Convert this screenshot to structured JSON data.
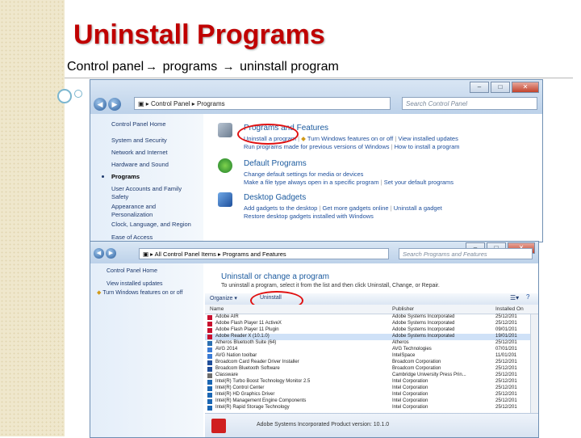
{
  "slide": {
    "title": "Uninstall Programs",
    "path": [
      "Control panel",
      "programs",
      "uninstall program"
    ]
  },
  "window1": {
    "address": [
      "Control Panel",
      "Programs"
    ],
    "search_placeholder": "Search Control Panel",
    "sidebar": [
      {
        "label": "Control Panel Home",
        "current": false
      },
      {
        "label": "System and Security",
        "current": false
      },
      {
        "label": "Network and Internet",
        "current": false
      },
      {
        "label": "Hardware and Sound",
        "current": false
      },
      {
        "label": "Programs",
        "current": true
      },
      {
        "label": "User Accounts and Family Safety",
        "current": false
      },
      {
        "label": "Appearance and Personalization",
        "current": false
      },
      {
        "label": "Clock, Language, and Region",
        "current": false
      },
      {
        "label": "Ease of Access",
        "current": false
      }
    ],
    "categories": [
      {
        "title": "Programs and Features",
        "links1": [
          "Uninstall a program",
          "Turn Windows features on or off",
          "View installed updates"
        ],
        "links2": [
          "Run programs made for previous versions of Windows",
          "How to install a program"
        ]
      },
      {
        "title": "Default Programs",
        "links1": [
          "Change default settings for media or devices"
        ],
        "links2": [
          "Make a file type always open in a specific program",
          "Set your default programs"
        ]
      },
      {
        "title": "Desktop Gadgets",
        "links1": [
          "Add gadgets to the desktop",
          "Get more gadgets online",
          "Uninstall a gadget"
        ],
        "links2": [
          "Restore desktop gadgets installed with Windows"
        ]
      }
    ]
  },
  "window2": {
    "address": [
      "All Control Panel Items",
      "Programs and Features"
    ],
    "search_placeholder": "Search Programs and Features",
    "sidebar": [
      "Control Panel Home",
      "View installed updates",
      "Turn Windows features on or off"
    ],
    "heading": "Uninstall or change a program",
    "subtext": "To uninstall a program, select it from the list and then click Uninstall, Change, or Repair.",
    "toolbar": {
      "organize": "Organize ▾",
      "uninstall": "Uninstall"
    },
    "columns": [
      "Name",
      "Publisher",
      "Installed On"
    ],
    "rows": [
      {
        "name": "Adobe AIR",
        "publisher": "Adobe Systems Incorporated",
        "date": "25/12/201",
        "selected": false
      },
      {
        "name": "Adobe Flash Player 11 ActiveX",
        "publisher": "Adobe Systems Incorporated",
        "date": "25/12/201",
        "selected": false
      },
      {
        "name": "Adobe Flash Player 11 Plugin",
        "publisher": "Adobe Systems Incorporated",
        "date": "09/01/201",
        "selected": false
      },
      {
        "name": "Adobe Reader X (10.1.0)",
        "publisher": "Adobe Systems Incorporated",
        "date": "19/01/201",
        "selected": true
      },
      {
        "name": "Atheros Bluetooth Suite (64)",
        "publisher": "Atheros",
        "date": "25/12/201",
        "selected": false
      },
      {
        "name": "AVG 2014",
        "publisher": "AVG Technologies",
        "date": "07/01/201",
        "selected": false
      },
      {
        "name": "AVG Nation toolbar",
        "publisher": "IntelSpace",
        "date": "11/01/201",
        "selected": false
      },
      {
        "name": "Broadcom Card Reader Driver Installer",
        "publisher": "Broadcom Corporation",
        "date": "25/12/201",
        "selected": false
      },
      {
        "name": "Broadcom Bluetooth Software",
        "publisher": "Broadcom Corporation",
        "date": "25/12/201",
        "selected": false
      },
      {
        "name": "Classware",
        "publisher": "Cambridge University Press Prin...",
        "date": "25/12/201",
        "selected": false
      },
      {
        "name": "Intel(R) Turbo Boost Technology Monitor 2.5",
        "publisher": "Intel Corporation",
        "date": "25/12/201",
        "selected": false
      },
      {
        "name": "Intel(R) Control Center",
        "publisher": "Intel Corporation",
        "date": "25/12/201",
        "selected": false
      },
      {
        "name": "Intel(R) HD Graphics Driver",
        "publisher": "Intel Corporation",
        "date": "25/12/201",
        "selected": false
      },
      {
        "name": "Intel(R) Management Engine Components",
        "publisher": "Intel Corporation",
        "date": "25/12/201",
        "selected": false
      },
      {
        "name": "Intel(R) Rapid Storage Technology",
        "publisher": "Intel Corporation",
        "date": "25/12/201",
        "selected": false
      }
    ],
    "status": "Adobe Systems Incorporated  Product version: 10.1.0"
  }
}
